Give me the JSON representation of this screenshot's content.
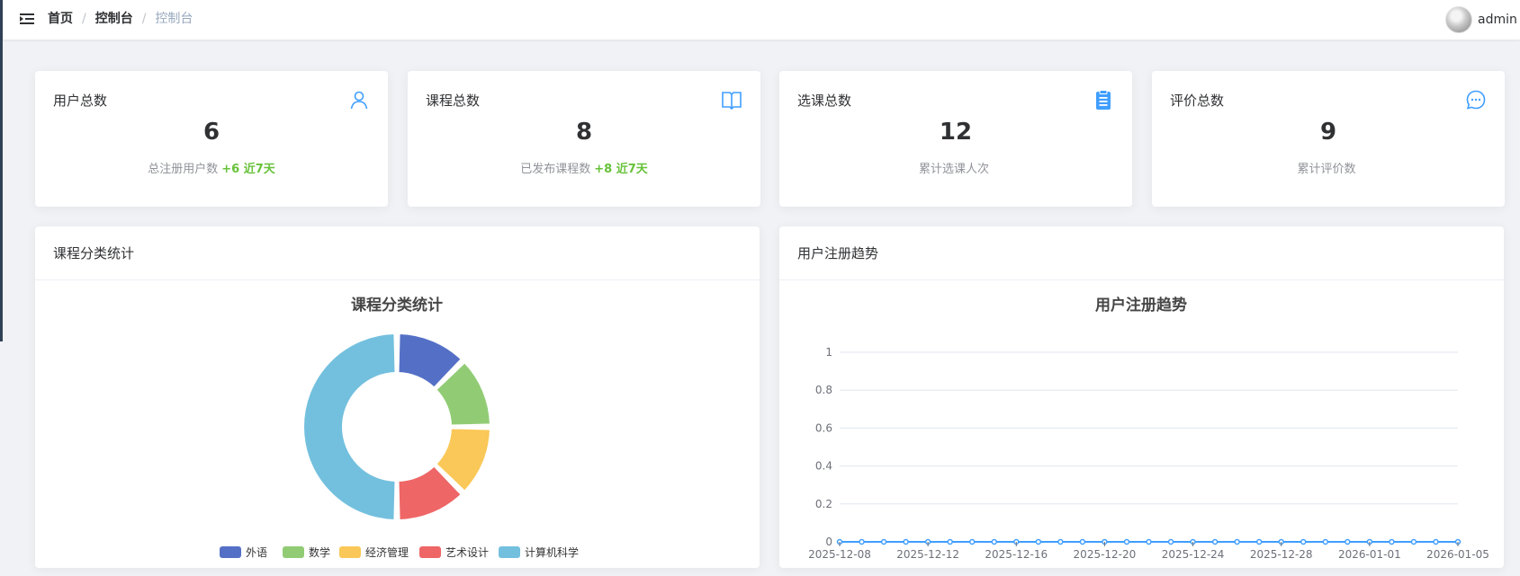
{
  "header": {
    "breadcrumb": [
      "首页",
      "控制台",
      "控制台"
    ],
    "user_name": "admin"
  },
  "stats": [
    {
      "title": "用户总数",
      "value": "6",
      "sub_text": "总注册用户数",
      "increment": "+6 近7天",
      "icon": "user-icon"
    },
    {
      "title": "课程总数",
      "value": "8",
      "sub_text": "已发布课程数",
      "increment": "+8 近7天",
      "icon": "book-icon"
    },
    {
      "title": "选课总数",
      "value": "12",
      "sub_text": "累计选课人次",
      "increment": "",
      "icon": "clipboard-icon"
    },
    {
      "title": "评价总数",
      "value": "9",
      "sub_text": "累计评价数",
      "increment": "",
      "icon": "chat-icon"
    }
  ],
  "colors": {
    "accent": "#409eff",
    "increase": "#67c23a"
  },
  "panels": {
    "category": {
      "header": "课程分类统计"
    },
    "trend": {
      "header": "用户注册趋势"
    }
  },
  "chart_data": [
    {
      "type": "pie",
      "title": "课程分类统计",
      "categories": [
        "外语",
        "数学",
        "经济管理",
        "艺术设计",
        "计算机科学"
      ],
      "values": [
        1,
        1,
        1,
        1,
        4
      ],
      "colors": [
        "#5470c6",
        "#91cc75",
        "#fac858",
        "#ee6666",
        "#73c0de"
      ],
      "legend": "bottom"
    },
    {
      "type": "line",
      "title": "用户注册趋势",
      "x": [
        "2025-12-08",
        "2025-12-09",
        "2025-12-10",
        "2025-12-11",
        "2025-12-12",
        "2025-12-13",
        "2025-12-14",
        "2025-12-15",
        "2025-12-16",
        "2025-12-17",
        "2025-12-18",
        "2025-12-19",
        "2025-12-20",
        "2025-12-21",
        "2025-12-22",
        "2025-12-23",
        "2025-12-24",
        "2025-12-25",
        "2025-12-26",
        "2025-12-27",
        "2025-12-28",
        "2025-12-29",
        "2025-12-30",
        "2025-12-31",
        "2026-01-01",
        "2026-01-02",
        "2026-01-03",
        "2026-01-04",
        "2026-01-05"
      ],
      "x_tick_labels": [
        "2025-12-08",
        "2025-12-12",
        "2025-12-16",
        "2025-12-20",
        "2025-12-24",
        "2025-12-28",
        "2026-01-01",
        "2026-01-05"
      ],
      "series": [
        {
          "values": [
            0,
            0,
            0,
            0,
            0,
            0,
            0,
            0,
            0,
            0,
            0,
            0,
            0,
            0,
            0,
            0,
            0,
            0,
            0,
            0,
            0,
            0,
            0,
            0,
            0,
            0,
            0,
            0,
            0
          ],
          "color": "#409eff"
        }
      ],
      "y_ticks": [
        "0",
        "0.2",
        "0.4",
        "0.6",
        "0.8",
        "1"
      ],
      "ylim": [
        0,
        1
      ],
      "grid": true
    }
  ]
}
